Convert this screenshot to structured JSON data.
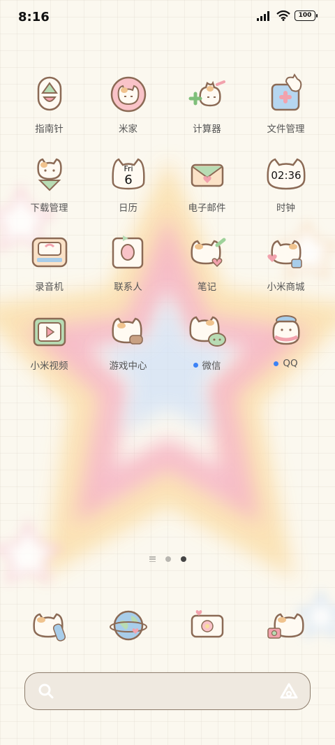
{
  "status_bar": {
    "time": "8:16",
    "battery": "100"
  },
  "apps": [
    {
      "label": "指南针",
      "icon": "compass-icon",
      "dot": false
    },
    {
      "label": "米家",
      "icon": "mi-home-icon",
      "dot": false
    },
    {
      "label": "计算器",
      "icon": "calculator-icon",
      "dot": false
    },
    {
      "label": "文件管理",
      "icon": "file-manager-icon",
      "dot": false
    },
    {
      "label": "下载管理",
      "icon": "download-icon",
      "dot": false
    },
    {
      "label": "日历",
      "icon": "calendar-icon",
      "dot": false,
      "day": "Fri",
      "date": "6"
    },
    {
      "label": "电子邮件",
      "icon": "email-icon",
      "dot": false
    },
    {
      "label": "时钟",
      "icon": "clock-icon",
      "dot": false,
      "clock": "02:36"
    },
    {
      "label": "录音机",
      "icon": "recorder-icon",
      "dot": false
    },
    {
      "label": "联系人",
      "icon": "contacts-icon",
      "dot": false
    },
    {
      "label": "笔记",
      "icon": "notes-icon",
      "dot": false
    },
    {
      "label": "小米商城",
      "icon": "mi-store-icon",
      "dot": false
    },
    {
      "label": "小米视频",
      "icon": "mi-video-icon",
      "dot": false
    },
    {
      "label": "游戏中心",
      "icon": "game-center-icon",
      "dot": false
    },
    {
      "label": "微信",
      "icon": "wechat-icon",
      "dot": true
    },
    {
      "label": "QQ",
      "icon": "qq-icon",
      "dot": true
    }
  ],
  "dock": [
    {
      "icon": "phone-icon"
    },
    {
      "icon": "browser-icon"
    },
    {
      "icon": "gallery-icon"
    },
    {
      "icon": "camera-icon"
    }
  ],
  "pager": {
    "pages": 2,
    "current": 2
  },
  "colors": {
    "notification_dot": "#3c82f6",
    "cat_outline": "#8b6a55",
    "pink": "#f2a2ad",
    "green": "#9ed29a",
    "blue": "#a8cdea"
  }
}
